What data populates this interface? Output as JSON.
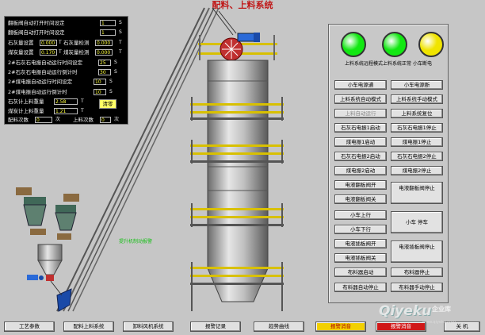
{
  "title": "配料、上料系统",
  "params": {
    "rows": [
      {
        "label": "翻板阀自动打开时间设定",
        "value": "1",
        "unit": "S"
      },
      {
        "label": "翻板阀自动打开时间设定",
        "value": "1",
        "unit": "S"
      },
      {
        "label": "石灰量设置",
        "value": "0.000",
        "unit": "T",
        "label2": "石灰量检测",
        "value2": "0.000",
        "unit2": "T"
      },
      {
        "label": "煤炭量设置",
        "value": "0.170",
        "unit": "T",
        "label2": "煤炭量检测",
        "value2": "0.000",
        "unit2": "T"
      },
      {
        "label": "2#石灰石电振自动运行时间设定",
        "value": "25",
        "unit": "S"
      },
      {
        "label": "2#石灰石电振自动运行倒计时",
        "value": "30",
        "unit": "S"
      },
      {
        "label": "2#煤电振自动运行时间设定",
        "value": "10",
        "unit": "S"
      },
      {
        "label": "2#煤电振自动运行倒计时",
        "value": "10",
        "unit": "S"
      },
      {
        "label": "石灰计上料重量",
        "value": "2.58",
        "unit": "T"
      },
      {
        "label": "煤炭计上料重量",
        "value": "1.21",
        "unit": "T"
      }
    ],
    "batch_label": "配料次数",
    "batch_value": "0",
    "batch_unit": "次",
    "load_label": "上料次数",
    "load_value": "0",
    "load_unit": "次",
    "clear_label": "清零"
  },
  "lamps": [
    {
      "name": "remote-mode",
      "color": "#12e812"
    },
    {
      "name": "system-normal",
      "color": "#12e812"
    },
    {
      "name": "trolley-power",
      "color": "#f0e400"
    }
  ],
  "lamp_caption": "上料系统远程模式上料系统正常 小车断电",
  "controls": {
    "trolley_power_on": "小车电源通",
    "trolley_power_off": "小车电源断",
    "load_auto": "上料系统自动模式",
    "load_manual": "上料系统手动模式",
    "load_auto_run": "上料自动运行",
    "load_reset": "上料系统复位",
    "lime_vib1_start": "石灰石电振1启动",
    "lime_vib1_stop": "石灰石电振1停止",
    "coal_vib1_start": "煤电振1启动",
    "coal_vib1_stop": "煤电振1停止",
    "lime_vib2_start": "石灰石电振2启动",
    "lime_vib2_stop": "石灰石电振2停止",
    "coal_vib2_start": "煤电振2启动",
    "coal_vib2_stop": "煤电振2停止",
    "flap_open": "电液翻板阀开",
    "flap_close": "电液翻板阀关",
    "flap_stop": "电液翻板阀停止",
    "trolley_up": "小车上行",
    "trolley_down": "小车下行",
    "trolley_stop": "小车 停车",
    "plug_open": "电液插板阀开",
    "plug_close": "电液插板阀关",
    "plug_stop": "电液插板阀停止",
    "dist_start": "布料器启动",
    "dist_stop": "布料器停止",
    "dist_auto_stop": "布料器自动停止",
    "dist_manual_stop": "布料器手动停止"
  },
  "hoist_label": "提升机制动报警",
  "nav": [
    {
      "label": "工艺参数"
    },
    {
      "label": "配料上料系统"
    },
    {
      "label": "卸料风机系统"
    },
    {
      "label": "报警记录"
    },
    {
      "label": "趋势曲线"
    },
    {
      "label": "报警消音"
    },
    {
      "label": "报警消音"
    },
    {
      "label": "关 机"
    }
  ],
  "watermark": {
    "text": "Qiyeku",
    "sub": "企业库",
    "url": "www.qiyeku.com"
  }
}
